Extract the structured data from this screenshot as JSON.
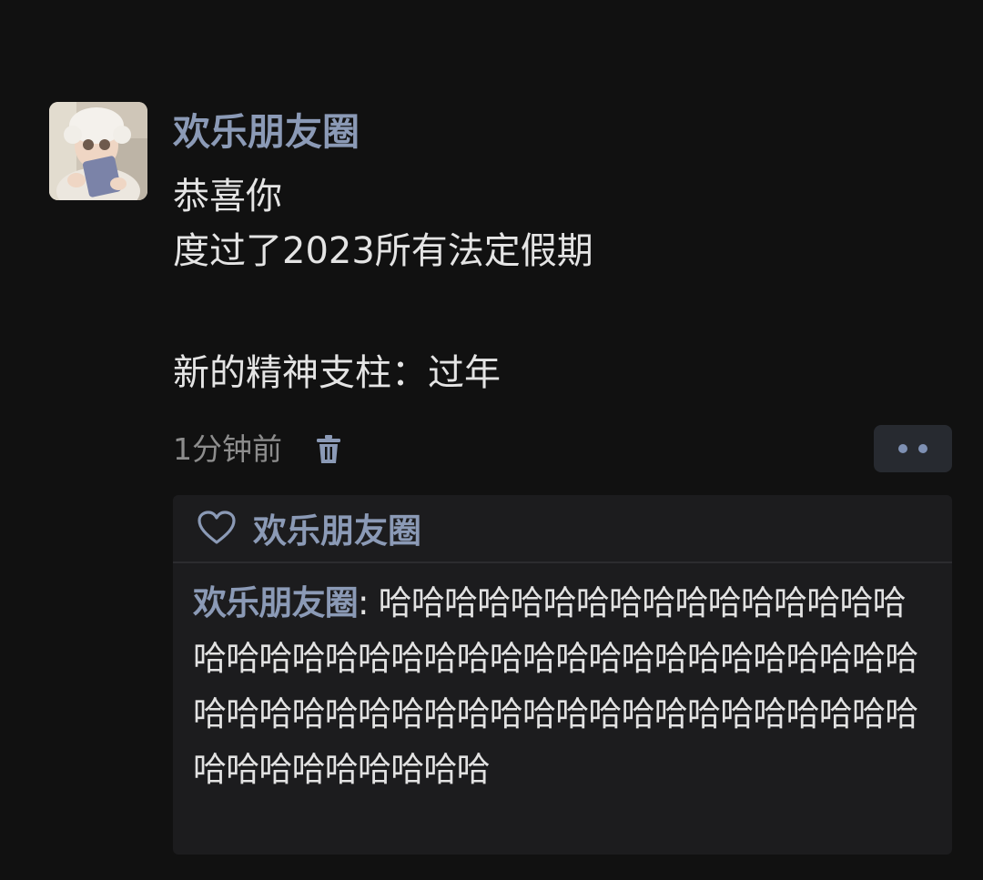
{
  "post": {
    "author": "欢乐朋友圈",
    "lines": [
      "恭喜你",
      "度过了2023所有法定假期"
    ],
    "lines2": [
      "新的精神支柱：过年"
    ],
    "time": "1分钟前"
  },
  "icons": {
    "avatar": "baby-avatar-photo",
    "delete": "trash-icon",
    "more": "more-dots-icon",
    "like": "heart-icon"
  },
  "colors": {
    "background": "#111111",
    "name": "#8b9ab6",
    "panel": "#1c1c1e"
  },
  "likes": {
    "name": "欢乐朋友圈"
  },
  "comments": [
    {
      "author": "欢乐朋友圈",
      "separator": ": ",
      "text": "哈哈哈哈哈哈哈哈哈哈哈哈哈哈哈哈哈哈哈哈哈哈哈哈哈哈哈哈哈哈哈哈哈哈哈哈哈哈哈哈哈哈哈哈哈哈哈哈哈哈哈哈哈哈哈哈哈哈哈哈哈哈哈哈哈哈哈哈哈"
    }
  ]
}
